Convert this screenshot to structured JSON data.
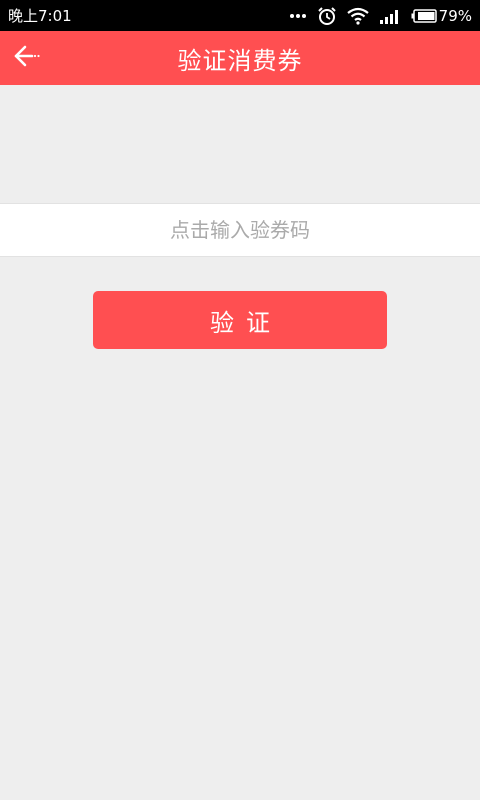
{
  "status_bar": {
    "time": "晚上7:01",
    "more_icon": "dots-icon",
    "alarm_icon": "alarm-clock-icon",
    "wifi_icon": "wifi-icon",
    "signal_icon": "signal-bars-icon",
    "battery_icon": "battery-icon",
    "battery": "79%"
  },
  "header": {
    "back_icon": "back-arrow-icon",
    "title": "验证消费券"
  },
  "form": {
    "code_placeholder": "点击输入验券码",
    "code_value": "",
    "verify_label": "验证"
  },
  "colors": {
    "accent": "#ff4f51",
    "background": "#eeeeee",
    "status_bar": "#000000"
  }
}
